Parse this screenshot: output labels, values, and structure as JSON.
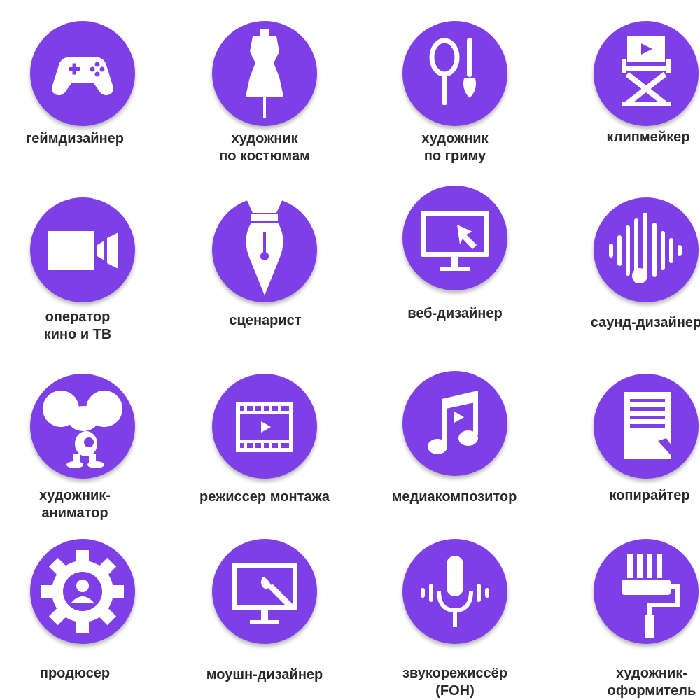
{
  "accent": "#7f3fe7",
  "professions": [
    {
      "label": [
        "геймдизайнер"
      ],
      "icon": "gamepad-icon"
    },
    {
      "label": [
        "художник",
        "по костюмам"
      ],
      "icon": "mannequin-icon"
    },
    {
      "label": [
        "художник",
        "по гриму"
      ],
      "icon": "mirror-brush-icon"
    },
    {
      "label": [
        "клипмейкер"
      ],
      "icon": "director-chair-icon"
    },
    {
      "label": [
        "оператор",
        "кино и ТВ"
      ],
      "icon": "video-camera-icon"
    },
    {
      "label": [
        "сценарист"
      ],
      "icon": "fountain-pen-icon"
    },
    {
      "label": [
        "веб-дизайнер"
      ],
      "icon": "monitor-cursor-icon"
    },
    {
      "label": [
        "саунд-дизайнер"
      ],
      "icon": "sound-wave-note-icon"
    },
    {
      "label": [
        "художник-",
        "аниматор"
      ],
      "icon": "cartoon-mouse-icon"
    },
    {
      "label": [
        "режиссер монтажа"
      ],
      "icon": "film-strip-icon"
    },
    {
      "label": [
        "медиакомпозитор"
      ],
      "icon": "music-note-icon"
    },
    {
      "label": [
        "копирайтер"
      ],
      "icon": "document-pen-icon"
    },
    {
      "label": [
        "продюсер"
      ],
      "icon": "gear-person-icon"
    },
    {
      "label": [
        "моушн-дизайнер"
      ],
      "icon": "monitor-brush-icon"
    },
    {
      "label": [
        "звукорежиссёр",
        "(FOH)"
      ],
      "icon": "microphone-wave-icon"
    },
    {
      "label": [
        "художник-",
        "оформитель"
      ],
      "icon": "paint-roller-icon"
    }
  ]
}
